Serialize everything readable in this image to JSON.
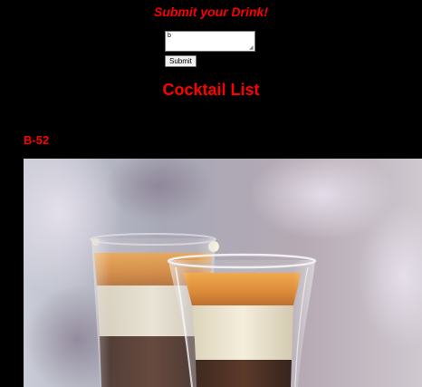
{
  "form": {
    "title": "Submit your Drink!",
    "input_value": "b",
    "submit_label": "Submit"
  },
  "list": {
    "title": "Cocktail List",
    "items": [
      {
        "name": "B-52",
        "photo": "layered shot glasses photo"
      }
    ]
  },
  "colors": {
    "background": "#000000",
    "heading": "#ff0000"
  }
}
